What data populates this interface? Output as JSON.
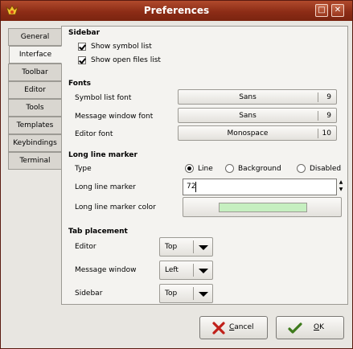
{
  "window": {
    "title": "Preferences",
    "minimize_glyph": "□",
    "close_glyph": "✕",
    "app_icon": "geany-icon"
  },
  "tabs": [
    "General",
    "Interface",
    "Toolbar",
    "Editor",
    "Tools",
    "Templates",
    "Keybindings",
    "Terminal"
  ],
  "active_tab": "Interface",
  "sidebar": {
    "heading": "Sidebar",
    "show_symbol_list": "Show symbol list",
    "show_open_files": "Show open files list"
  },
  "fonts": {
    "heading": "Fonts",
    "symbol_label": "Symbol list font",
    "symbol_font": "Sans",
    "symbol_size": "9",
    "message_label": "Message window font",
    "message_font": "Sans",
    "message_size": "9",
    "editor_label": "Editor font",
    "editor_font": "Monospace",
    "editor_size": "10"
  },
  "marker": {
    "heading": "Long line marker",
    "type_label": "Type",
    "opt_line": "Line",
    "opt_background": "Background",
    "opt_disabled": "Disabled",
    "selected": "Line",
    "marker_label": "Long line marker",
    "marker_value": "72",
    "color_label": "Long line marker color",
    "color_value": "#c6efc0"
  },
  "tab_placement": {
    "heading": "Tab placement",
    "editor_label": "Editor",
    "editor_value": "Top",
    "message_label": "Message window",
    "message_value": "Left",
    "sidebar_label": "Sidebar",
    "sidebar_value": "Top"
  },
  "buttons": {
    "cancel_label": "Cancel",
    "cancel_mnemonic": "C",
    "cancel_rest": "ancel",
    "ok_label": "OK",
    "ok_mnemonic": "O",
    "ok_rest": "K"
  }
}
